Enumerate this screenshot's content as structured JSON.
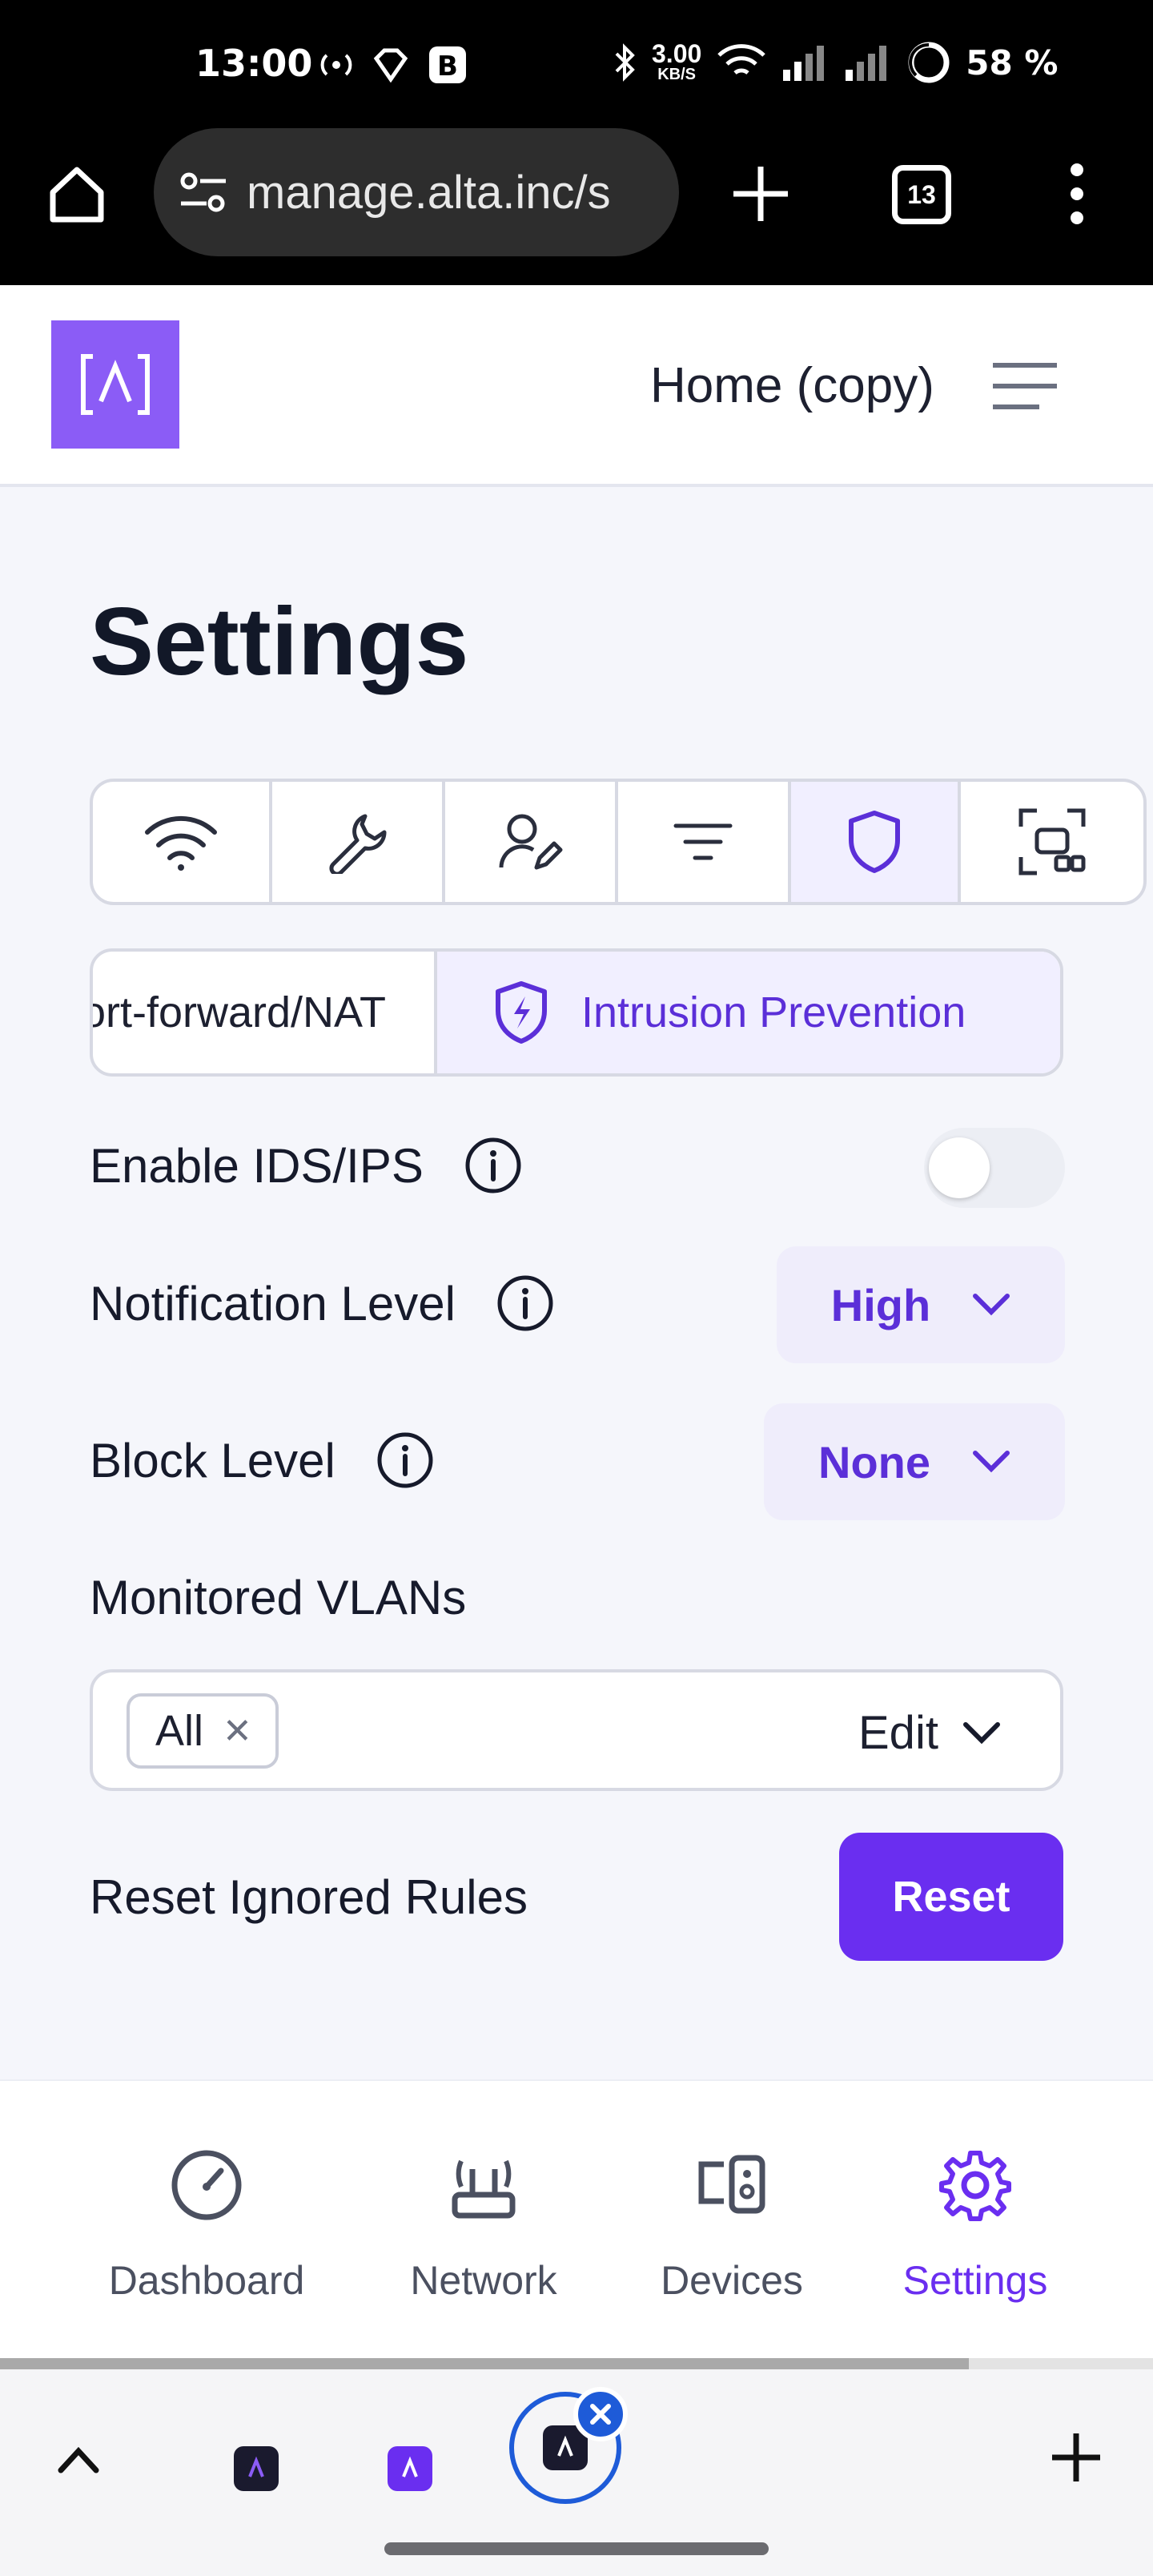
{
  "status_bar": {
    "time": "13:00",
    "speed_value": "3.00",
    "speed_unit": "KB/S",
    "battery": "58 %"
  },
  "browser": {
    "url": "manage.alta.inc/s",
    "tab_count": "13"
  },
  "header": {
    "title": "Home (copy)"
  },
  "page": {
    "title": "Settings"
  },
  "icon_tabs": [
    "wifi-icon",
    "wrench-icon",
    "user-edit-icon",
    "filter-icon",
    "shield-icon",
    "qr-code-icon"
  ],
  "active_icon_tab": "shield-icon",
  "sub_tabs": {
    "first": "Port-forward/NAT",
    "active": "Intrusion Prevention"
  },
  "settings": {
    "ids_label": "Enable IDS/IPS",
    "ids_enabled": false,
    "notification_label": "Notification Level",
    "notification_value": "High",
    "block_label": "Block Level",
    "block_value": "None",
    "vlans_label": "Monitored VLANs",
    "vlan_chip": "All",
    "vlan_edit": "Edit",
    "reset_label": "Reset Ignored Rules",
    "reset_button": "Reset"
  },
  "bottom_nav": [
    {
      "label": "Dashboard",
      "icon": "speedometer-icon"
    },
    {
      "label": "Network",
      "icon": "router-icon"
    },
    {
      "label": "Devices",
      "icon": "devices-icon"
    },
    {
      "label": "Settings",
      "icon": "gear-icon"
    }
  ],
  "colors": {
    "accent": "#6a2ef0",
    "accent_light": "#f1efff",
    "logo": "#8b5cf6",
    "tab_blue": "#1e5bd8"
  }
}
